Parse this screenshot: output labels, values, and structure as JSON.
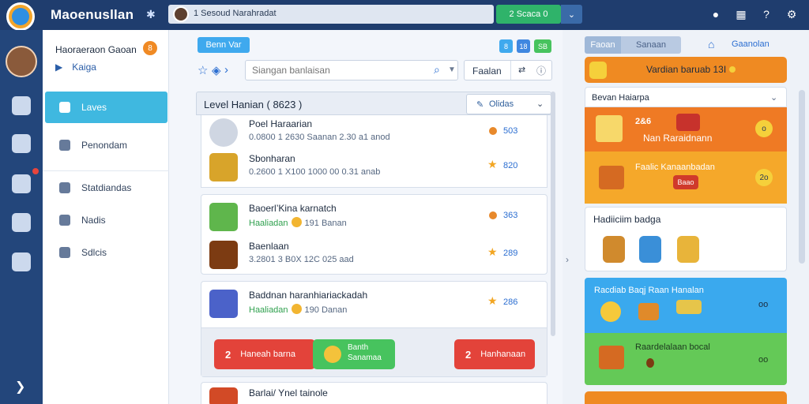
{
  "app": {
    "brand": "Maoenusllan"
  },
  "topbar": {
    "search_text": "1   Sesoud Narahradat",
    "green_button": "2  Scaca 0",
    "icons": [
      "info-icon",
      "grid-icon",
      "help-icon",
      "settings-icon"
    ]
  },
  "sidebar": {
    "title": "Haoraeraon Gaoan",
    "coin_label": "8",
    "subtitle": "Kaiga",
    "items": [
      {
        "label": "Laves",
        "active": true
      },
      {
        "label": "Penondam",
        "active": false
      },
      {
        "label": "Statdiandas",
        "active": false
      },
      {
        "label": "Nadis",
        "active": false
      },
      {
        "label": "Sdlcis",
        "active": false
      }
    ]
  },
  "toolbar": {
    "tab_label": "Benn Var",
    "search_placeholder": "Siangan banlaisan",
    "filter_label": "Faalan",
    "square_labels": [
      "8",
      "18",
      "SB"
    ]
  },
  "list": {
    "title": "Level Hanian  ( 8623 )",
    "combo_label": "Olidas",
    "entries": [
      {
        "name": "Poel Haraarian",
        "meta": "0.0800 1 2630 Saanan 2.30 a1 anod",
        "score": "503",
        "marker": "dot",
        "thumb": "#cfd6e2"
      },
      {
        "name": "Sbonharan",
        "meta": "0.2600 1 X100 1000 00 0.31 anab",
        "score": "820",
        "marker": "star",
        "thumb": "#d8a42a"
      },
      {
        "name": "Baoerl’Kina karnatch",
        "meta": "Haaliadan",
        "meta_suffix": "191 Banan",
        "coin": true,
        "score": "363",
        "marker": "dot",
        "thumb": "#5fb64c"
      },
      {
        "name": "Baenlaan",
        "meta": "3.2801 3 B0X 12C 025 aad",
        "score": "289",
        "marker": "star",
        "thumb": "#7c3b12"
      },
      {
        "name": "Baddnan haranhiariackadah",
        "meta": "Haaliadan",
        "meta_suffix": "190 Danan",
        "coin": true,
        "score": "286",
        "marker": "star",
        "thumb": "#4b62c9"
      },
      {
        "name": "Barlai/ Ynel tainole",
        "meta": "",
        "score": "",
        "marker": "none",
        "thumb": "#d24a26"
      }
    ],
    "actions": {
      "left": {
        "num": "2",
        "label": "Haneah barna",
        "color": "#e3433a"
      },
      "middle": {
        "line1": "Banth",
        "line2": "Sanamaa"
      },
      "right": {
        "num": "2",
        "label": "Hanhanaan",
        "color": "#e3433a"
      }
    }
  },
  "right": {
    "tabs": [
      "Faoan",
      "Sanaan"
    ],
    "link": "Gaanolan",
    "banner": "Vardian baruab 13I",
    "dropdown_header": "Bevan Haiarpa",
    "rows": [
      {
        "title": "Nan Raraidnann",
        "num": "2&6",
        "bg": "#ef7a24",
        "badge": "o"
      },
      {
        "title": "Faalic Kanaanbadan",
        "num": "",
        "bg": "#f5a82a",
        "badge": "2o",
        "tag": "Baao"
      },
      {
        "title": "Racdiab Baqj Raan Hanalan",
        "num": "",
        "bg": "#3aa9ee",
        "badge": "oo"
      },
      {
        "title": "Raardelalaan bocal",
        "num": "",
        "bg": "#64c957",
        "badge": "oo"
      }
    ],
    "badges_title": "Hadiiciim badga"
  },
  "colors": {
    "accent": "#3fb8e0",
    "nav": "#1f3d6e",
    "warn": "#ef8a22",
    "success": "#47c35e"
  }
}
